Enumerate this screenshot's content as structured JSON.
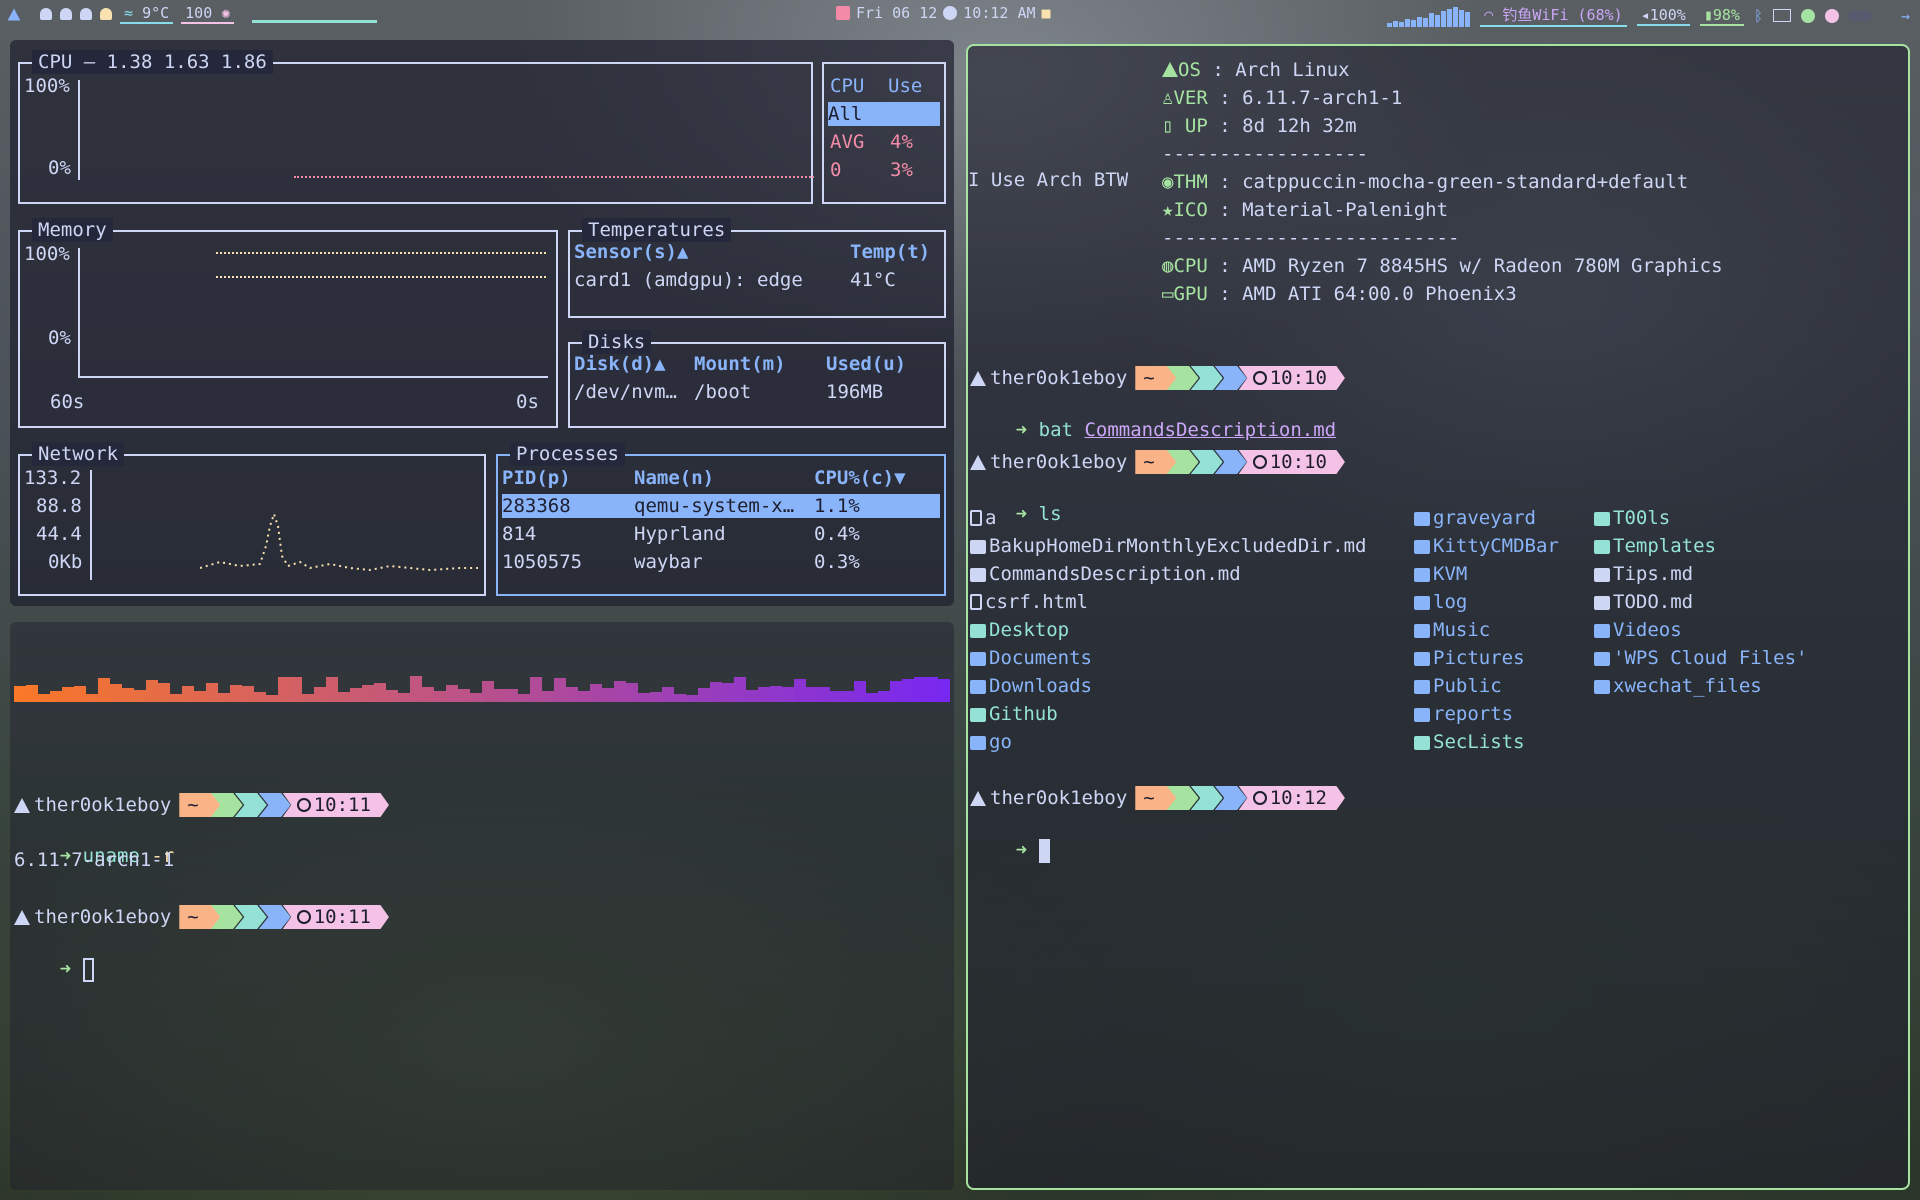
{
  "topbar": {
    "temp": "9°C",
    "brightness": "100",
    "date": "Fri 06 12",
    "time": "10:12 AM",
    "wifi": "钓鱼WiFi (68%)",
    "volume": "100%",
    "battery": "98%"
  },
  "btop": {
    "cpu": {
      "title": "CPU — 1.38 1.63 1.86",
      "ymax": "100%",
      "ymin": "0%",
      "list_h_cpu": "CPU",
      "list_h_use": "Use",
      "row_all": "All",
      "row_avg": "AVG",
      "row_avg_val": "4%",
      "row_0": "0",
      "row_0_val": "3%"
    },
    "memory": {
      "title": "Memory",
      "ymax": "100%",
      "ymin": "0%",
      "x_left": "60s",
      "x_right": "0s"
    },
    "temps": {
      "title": "Temperatures",
      "h_sensor": "Sensor(s)▲",
      "h_temp": "Temp(t)",
      "sensor": "card1 (amdgpu): edge",
      "temp": "41°C"
    },
    "disks": {
      "title": "Disks",
      "h_disk": "Disk(d)▲",
      "h_mount": "Mount(m)",
      "h_used": "Used(u)",
      "disk": "/dev/nvm…",
      "mount": "/boot",
      "used": "196MB"
    },
    "network": {
      "title": "Network",
      "y1": "133.2",
      "y2": "88.8",
      "y3": "44.4",
      "y4": "0Kb"
    },
    "processes": {
      "title": "Processes",
      "h_pid": "PID(p)",
      "h_name": "Name(n)",
      "h_cpu": "CPU%(c)▼",
      "rows": [
        {
          "pid": "283368",
          "name": "qemu-system-x…",
          "cpu": "1.1%"
        },
        {
          "pid": "814",
          "name": "Hyprland",
          "cpu": "0.4%"
        },
        {
          "pid": "1050575",
          "name": "waybar",
          "cpu": "0.3%"
        }
      ]
    }
  },
  "left_term": {
    "user": "ther0ok1eboy",
    "home": "~",
    "time1": "10:11",
    "cmd1": "uname",
    "cmd1_arg": "-r",
    "out1": "6.11.7-arch1-1",
    "time2": "10:11"
  },
  "fetch": {
    "side": "I Use Arch BTW",
    "os_k": "OS",
    "os_v": ": Arch Linux",
    "ver_k": "VER",
    "ver_v": ": 6.11.7-arch1-1",
    "up_k": "UP",
    "up_v": ": 8d 12h 32m",
    "sep1": "------------------",
    "thm_k": "THM",
    "thm_v": ": catppuccin-mocha-green-standard+default",
    "ico_k": "ICO",
    "ico_v": ": Material-Palenight",
    "sep2": "--------------------------",
    "cpu_k": "CPU",
    "cpu_v": ": AMD Ryzen 7 8845HS w/ Radeon 780M Graphics",
    "gpu_k": "GPU",
    "gpu_v": ": AMD ATI 64:00.0 Phoenix3"
  },
  "right_term": {
    "user": "ther0ok1eboy",
    "home": "~",
    "time1": "10:10",
    "cmd1": "bat",
    "cmd1_arg": "CommandsDescription.md",
    "time2": "10:10",
    "cmd2": "ls",
    "time3": "10:12",
    "ls_col1": [
      "a",
      "BakupHomeDirMonthlyExcludedDir.md",
      "CommandsDescription.md",
      "csrf.html",
      "Desktop",
      "Documents",
      "Downloads",
      "Github",
      "go"
    ],
    "ls_col2": [
      "graveyard",
      "KittyCMDBar",
      "KVM",
      "log",
      "Music",
      "Pictures",
      "Public",
      "reports",
      "SecLists"
    ],
    "ls_col3": [
      "T00ls",
      "Templates",
      "Tips.md",
      "TODO.md",
      "Videos",
      "'WPS Cloud Files'",
      "xwechat_files"
    ]
  }
}
